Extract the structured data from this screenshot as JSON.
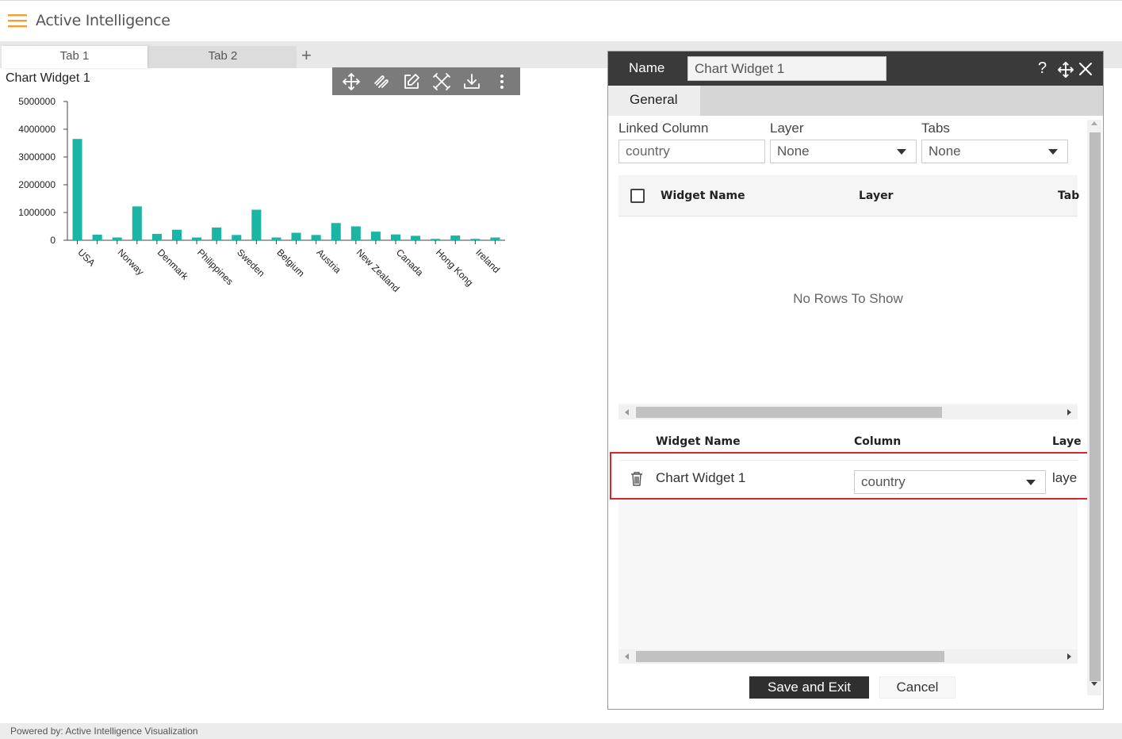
{
  "app": {
    "title": "Active Intelligence"
  },
  "tabs": [
    {
      "label": "Tab 1"
    },
    {
      "label": "Tab 2"
    }
  ],
  "tab_add_label": "+",
  "widget": {
    "title": "Chart Widget 1"
  },
  "chart_data": {
    "type": "bar",
    "title": "",
    "xlabel": "",
    "ylabel": "",
    "ylim": [
      0,
      5000000
    ],
    "yticks": [
      "5000000",
      "4000000",
      "3000000",
      "2000000",
      "1000000",
      "0"
    ],
    "categories": [
      "USA",
      "",
      "Norway",
      "",
      "Denmark",
      "",
      "Philippines",
      "",
      "Sweden",
      "",
      "Belgium",
      "",
      "Austria",
      "",
      "New Zealand",
      "",
      "Canada",
      "",
      "Hong Kong",
      "",
      "Ireland",
      ""
    ],
    "values": [
      3650000,
      200000,
      100000,
      1220000,
      230000,
      380000,
      100000,
      460000,
      190000,
      1100000,
      100000,
      270000,
      190000,
      620000,
      500000,
      310000,
      210000,
      160000,
      50000,
      170000,
      50000,
      100000
    ],
    "color": "#1ab5a3"
  },
  "dialog": {
    "name_label": "Name",
    "name_value": "Chart Widget 1",
    "help_label": "?",
    "tab_general": "General",
    "linked_column_label": "Linked Column",
    "linked_column_value": "country",
    "layer_label": "Layer",
    "layer_value": "None",
    "tabs_label": "Tabs",
    "tabs_value": "None",
    "grid1": {
      "columns": [
        "Widget Name",
        "Layer",
        "Tab"
      ],
      "empty_message": "No Rows To Show"
    },
    "grid2": {
      "columns": [
        "Widget Name",
        "Column",
        "Laye"
      ],
      "rows": [
        {
          "widget_name": "Chart Widget 1",
          "column": "country",
          "layer": "laye"
        }
      ]
    },
    "save_label": "Save and Exit",
    "cancel_label": "Cancel"
  },
  "footer": {
    "text": "Powered by: Active Intelligence Visualization"
  },
  "colors": {
    "accent": "#f0a030",
    "dark": "#3a3a3a",
    "highlight": "#d9232d"
  }
}
